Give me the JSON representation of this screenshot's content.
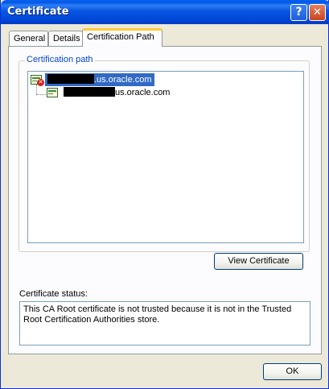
{
  "window": {
    "title": "Certificate",
    "help_glyph": "?",
    "close_glyph": "✕"
  },
  "tabs": [
    {
      "label": "General"
    },
    {
      "label": "Details"
    },
    {
      "label": "Certification Path",
      "active": true
    }
  ],
  "certification_path": {
    "group_label": "Certification path",
    "items": [
      {
        "label": ".us.oracle.com",
        "level": 0,
        "selected": true,
        "icon": "certificate-untrusted-icon"
      },
      {
        "label": "us.oracle.com",
        "level": 1,
        "selected": false,
        "icon": "certificate-icon"
      }
    ],
    "view_button_label": "View Certificate"
  },
  "status": {
    "label": "Certificate status:",
    "text": "This CA Root certificate is not trusted because it is not in the Trusted Root Certification Authorities store."
  },
  "footer": {
    "ok_label": "OK"
  },
  "colors": {
    "title_bar": "#0058e6",
    "selection": "#316ac5",
    "group_label": "#0046d5",
    "active_tab_accent": "#ffc83c"
  }
}
